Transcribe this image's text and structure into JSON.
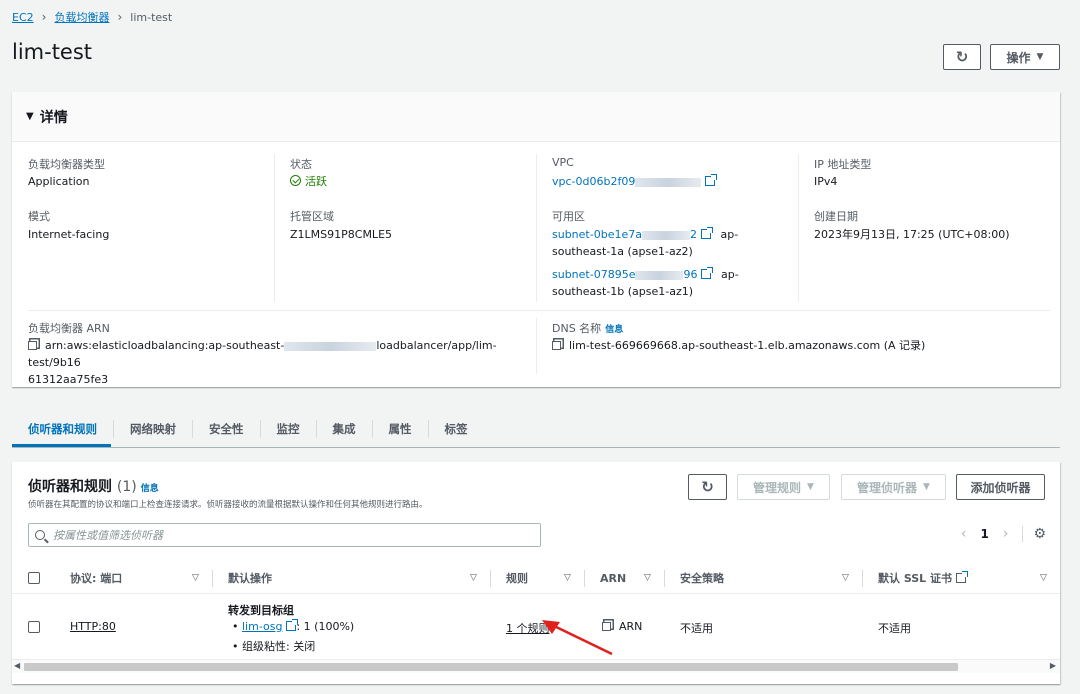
{
  "breadcrumb": {
    "root": "EC2",
    "parent": "负载均衡器",
    "current": "lim-test"
  },
  "page": {
    "title": "lim-test",
    "actions_label": "操作"
  },
  "details": {
    "section_title": "详情",
    "lb_type_label": "负载均衡器类型",
    "lb_type_value": "Application",
    "state_label": "状态",
    "state_value": "活跃",
    "vpc_label": "VPC",
    "vpc_value": "vpc-0d06b2f09",
    "ip_type_label": "IP 地址类型",
    "ip_type_value": "IPv4",
    "scheme_label": "模式",
    "scheme_value": "Internet-facing",
    "hosted_zone_label": "托管区域",
    "hosted_zone_value": "Z1LMS91P8CMLE5",
    "az_label": "可用区",
    "az1_subnet": "subnet-0be1e7a",
    "az1_subnet_end": "2",
    "az1_suffix": "ap-",
    "az1_zone": "southeast-1a (apse1-az2)",
    "az2_subnet": "subnet-07895e",
    "az2_subnet_end": "96",
    "az2_suffix": "ap-",
    "az2_zone": "southeast-1b (apse1-az1)",
    "created_label": "创建日期",
    "created_value": "2023年9月13日, 17:25 (UTC+08:00)",
    "arn_label": "负载均衡器 ARN",
    "arn_start": "arn:aws:elasticloadbalancing:ap-southeast-",
    "arn_end": "loadbalancer/app/lim-test/9b16",
    "arn_line2": "61312aa75fe3",
    "dns_label": "DNS 名称",
    "dns_info": "信息",
    "dns_value": "lim-test-669669668.ap-southeast-1.elb.amazonaws.com (A 记录)"
  },
  "tabs": [
    "侦听器和规则",
    "网络映射",
    "安全性",
    "监控",
    "集成",
    "属性",
    "标签"
  ],
  "listeners": {
    "title": "侦听器和规则",
    "count": "(1)",
    "info": "信息",
    "description": "侦听器在其配置的协议和端口上检查连接请求。侦听器接收的流量根据默认操作和任何其他规则进行路由。",
    "manage_rules": "管理规则",
    "manage_listeners": "管理侦听器",
    "add_listener": "添加侦听器",
    "search_placeholder": "按属性或值筛选侦听器",
    "page_number": "1",
    "columns": [
      "协议: 端口",
      "默认操作",
      "规则",
      "ARN",
      "安全策略",
      "默认 SSL 证书"
    ],
    "row": {
      "protocol_port": "HTTP:80",
      "action_title": "转发到目标组",
      "target_group": "lim-osg",
      "target_weight": ": 1 (100%)",
      "stickiness": "组级粘性: 关闭",
      "rules": "1 个规则",
      "arn": "ARN",
      "security_policy": "不适用",
      "ssl_cert": "不适用"
    }
  },
  "colors": {
    "link": "#0073bb",
    "success": "#1d8102",
    "annotation_arrow": "#e0201c"
  }
}
